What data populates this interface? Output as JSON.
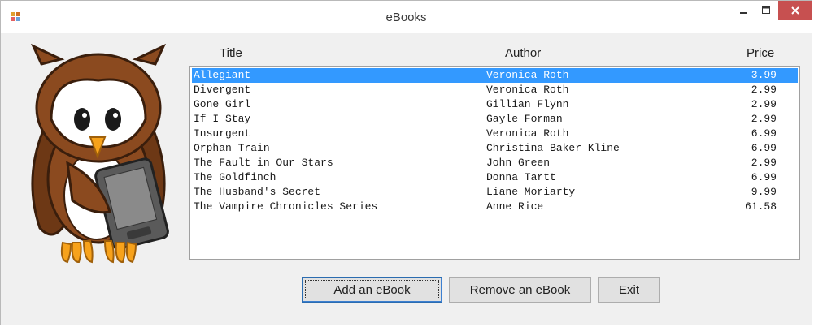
{
  "window": {
    "title": "eBooks",
    "close_color": "#c75050"
  },
  "columns": {
    "title": "Title",
    "author": "Author",
    "price": "Price"
  },
  "books": [
    {
      "title": "Allegiant",
      "author": "Veronica Roth",
      "price": "3.99",
      "selected": true
    },
    {
      "title": "Divergent",
      "author": "Veronica Roth",
      "price": "2.99"
    },
    {
      "title": "Gone Girl",
      "author": "Gillian Flynn",
      "price": "2.99"
    },
    {
      "title": "If I Stay",
      "author": "Gayle Forman",
      "price": "2.99"
    },
    {
      "title": "Insurgent",
      "author": "Veronica Roth",
      "price": "6.99"
    },
    {
      "title": "Orphan Train",
      "author": "Christina Baker Kline",
      "price": "6.99"
    },
    {
      "title": "The Fault in Our Stars",
      "author": "John Green",
      "price": "2.99"
    },
    {
      "title": "The Goldfinch",
      "author": "Donna Tartt",
      "price": "6.99"
    },
    {
      "title": "The Husband's Secret",
      "author": "Liane Moriarty",
      "price": "9.99"
    },
    {
      "title": "The Vampire Chronicles Series",
      "author": "Anne Rice",
      "price": "61.58"
    }
  ],
  "buttons": {
    "add": {
      "mnemonic": "A",
      "rest": "dd an eBook"
    },
    "remove": {
      "mnemonic": "R",
      "rest": "emove an eBook"
    },
    "exit": {
      "pre": "E",
      "mnemonic": "x",
      "rest": "it"
    }
  },
  "icons": {
    "app": "app-icon",
    "minimize": "minimize-icon",
    "maximize": "maximize-icon",
    "close": "close-icon",
    "mascot": "owl-with-ereader-illustration"
  },
  "colors": {
    "selection": "#3399ff",
    "owl_body": "#8b4a1f",
    "owl_beak": "#f7a21b"
  }
}
